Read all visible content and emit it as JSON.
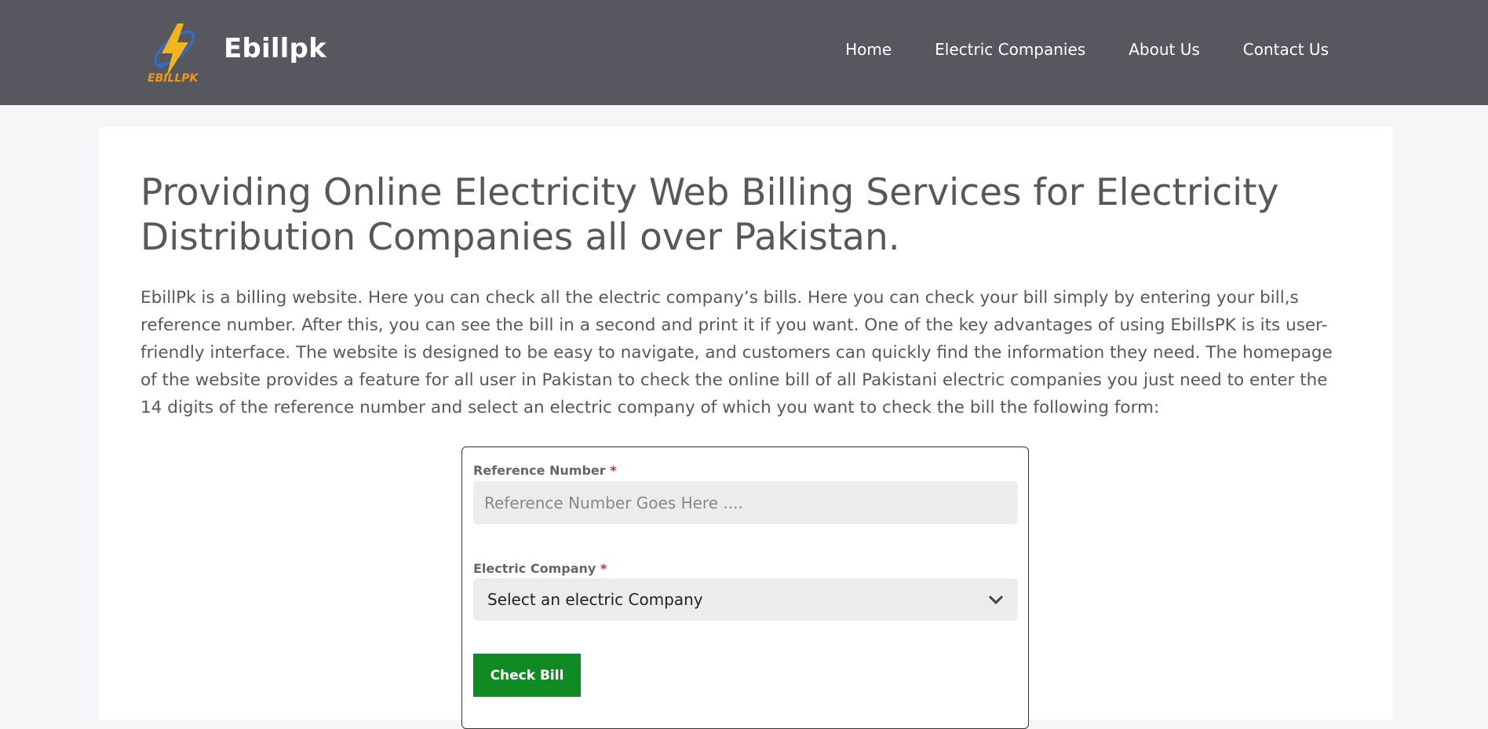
{
  "header": {
    "logo_text": "EBILLPK",
    "site_title": "Ebillpk",
    "nav": [
      "Home",
      "Electric Companies",
      "About Us",
      "Contact Us"
    ]
  },
  "main": {
    "headline": "Providing Online Electricity Web Billing Services for Electricity Distribution Companies all over Pakistan.",
    "intro": "EbillPk is a billing website. Here you can check all the electric company’s bills. Here you can check your bill simply by entering your bill,s reference number. After this, you can see the bill in a second and print it if you want. One of the key advantages of using EbillsPK is its user-friendly interface. The website is designed to be easy to navigate, and customers can quickly find the information they need. The homepage of the website provides a feature for all user in Pakistan to check the online bill of all Pakistani electric companies you just need to enter the 14 digits of the reference number and select an electric company of which you want to check the bill the following form:"
  },
  "form": {
    "reference_label": "Reference Number",
    "reference_placeholder": "Reference Number Goes Here ....",
    "company_label": "Electric Company",
    "company_selected": "Select an electric Company",
    "required_mark": "*",
    "submit_label": "Check Bill"
  },
  "colors": {
    "header_bg": "#575760",
    "button_bg": "#108a23",
    "required": "#d62d2d"
  },
  "icons": {
    "logo": "lightning-bolt-icon",
    "dropdown": "chevron-down-icon"
  }
}
